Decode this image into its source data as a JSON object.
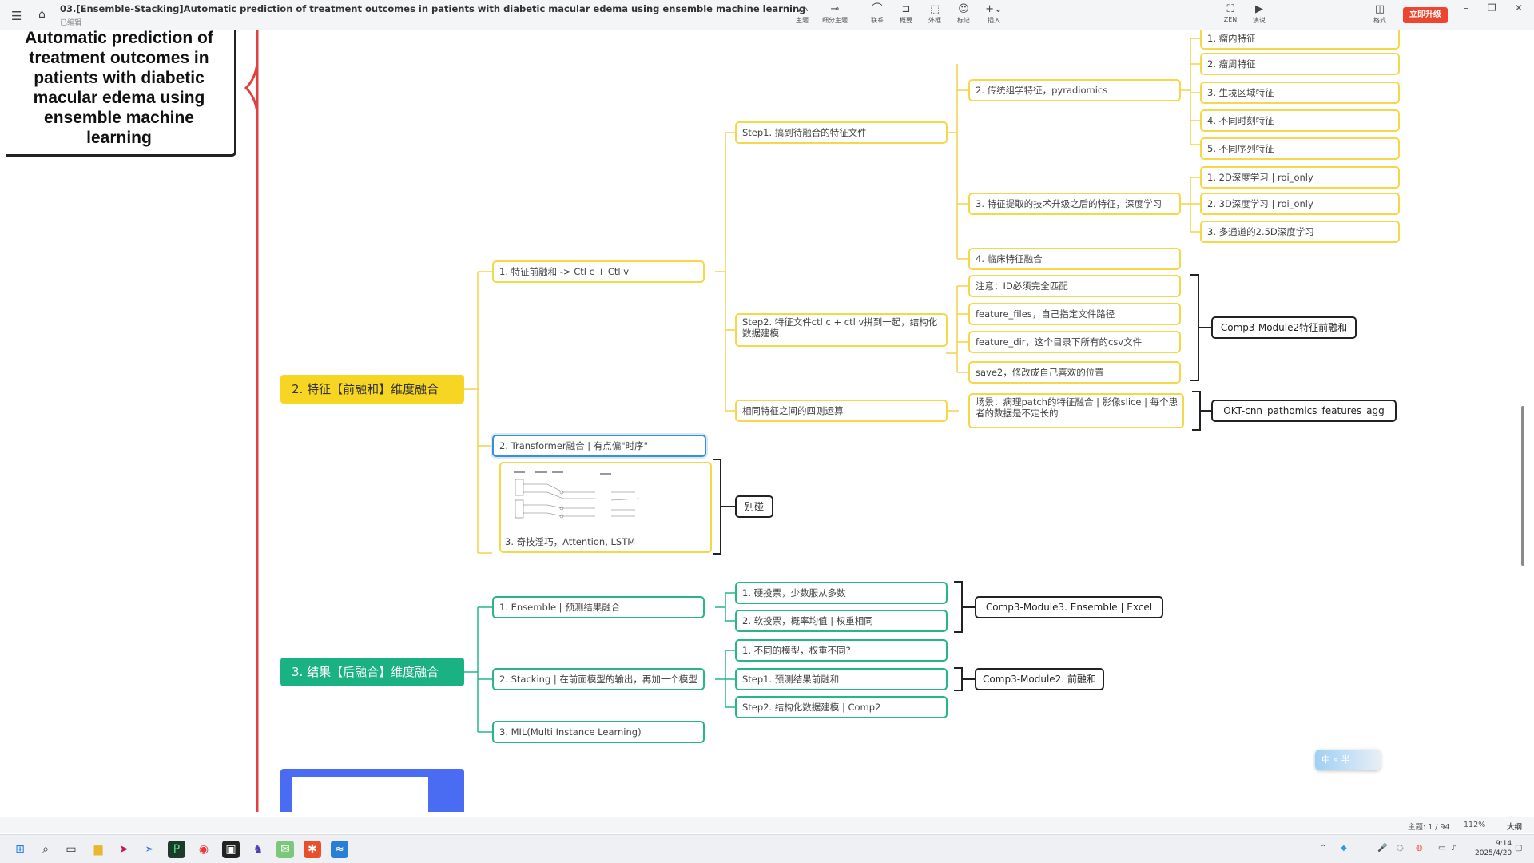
{
  "titlebar": {
    "doc_title": "03.[Ensemble-Stacking]Automatic prediction of treatment outcomes in patients with diabetic macular edema using ensemble machine learning",
    "status": "已编辑",
    "tools": [
      "主题",
      "细分主题",
      "联系",
      "概要",
      "外框",
      "标记",
      "插入"
    ],
    "view_tools": [
      "ZEN",
      "演说"
    ],
    "format": "格式",
    "upgrade": "立即升级"
  },
  "root": {
    "title": "Automatic prediction of treatment outcomes in patients with diabetic macular edema using ensemble machine learning"
  },
  "branch_feature": {
    "label": "2. 特征【前融和】维度融合",
    "child1": {
      "label": "1. 特征前融和 -> Ctl c + Ctl v",
      "step1": {
        "label": "Step1. 搞到待融合的特征文件",
        "items": [
          {
            "label": "2. 传统组学特征，pyradiomics",
            "sub": [
              "1. 瘤内特征",
              "2. 瘤周特征",
              "3. 生境区域特征",
              "4. 不同时刻特征",
              "5. 不同序列特征"
            ]
          },
          {
            "label": "3. 特征提取的技术升级之后的特征，深度学习",
            "sub": [
              "1. 2D深度学习 | roi_only",
              "2. 3D深度学习 | roi_only",
              "3. 多通道的2.5D深度学习"
            ]
          },
          {
            "label": "4. 临床特征融合"
          }
        ]
      },
      "step2": {
        "label": "Step2. 特征文件ctl c + ctl v拼到一起，结构化数据建模",
        "items": [
          "注意：ID必须完全匹配",
          "feature_files，自己指定文件路径",
          "feature_dir，这个目录下所有的csv文件",
          "save2，修改成自己喜欢的位置"
        ],
        "summary": "Comp3-Module2特征前融和"
      },
      "ops": {
        "label": "相同特征之间的四则运算",
        "item": "场景：病理patch的特征融合 | 影像slice | 每个患者的数据是不定长的",
        "summary": "OKT-cnn_pathomics_features_agg"
      }
    },
    "child2": {
      "label": "2. Transformer融合 | 有点偏\"时序\""
    },
    "child3": {
      "label": "3. 奇技淫巧，Attention, LSTM",
      "summary": "别碰"
    }
  },
  "branch_result": {
    "label": "3. 结果【后融合】维度融合",
    "ensemble": {
      "label": "1. Ensemble | 预测结果融合",
      "items": [
        "1. 硬投票，少数服从多数",
        "2. 软投票，概率均值 | 权重相同"
      ],
      "summary": "Comp3-Module3. Ensemble | Excel"
    },
    "stacking": {
      "label": "2. Stacking | 在前面模型的输出，再加一个模型",
      "items": [
        "1. 不同的模型，权重不同?",
        "Step1. 预测结果前融和",
        "Step2. 结构化数据建模 | Comp2"
      ],
      "summary": "Comp3-Module2. 前融和"
    },
    "mil": {
      "label": "3. MIL(Multi Instance Learning)"
    }
  },
  "widget": {
    "label": "中 ∘ 半"
  },
  "statusbar": {
    "topics": "主题: 1 / 94",
    "zoom": "112%",
    "outline": "大纲"
  },
  "clock": {
    "time": "9:14",
    "date": "2025/4/20"
  },
  "colors": {
    "yellow": "#f7d623",
    "green": "#1bb282",
    "red_line": "#e24040",
    "upgrade": "#ee4530"
  }
}
